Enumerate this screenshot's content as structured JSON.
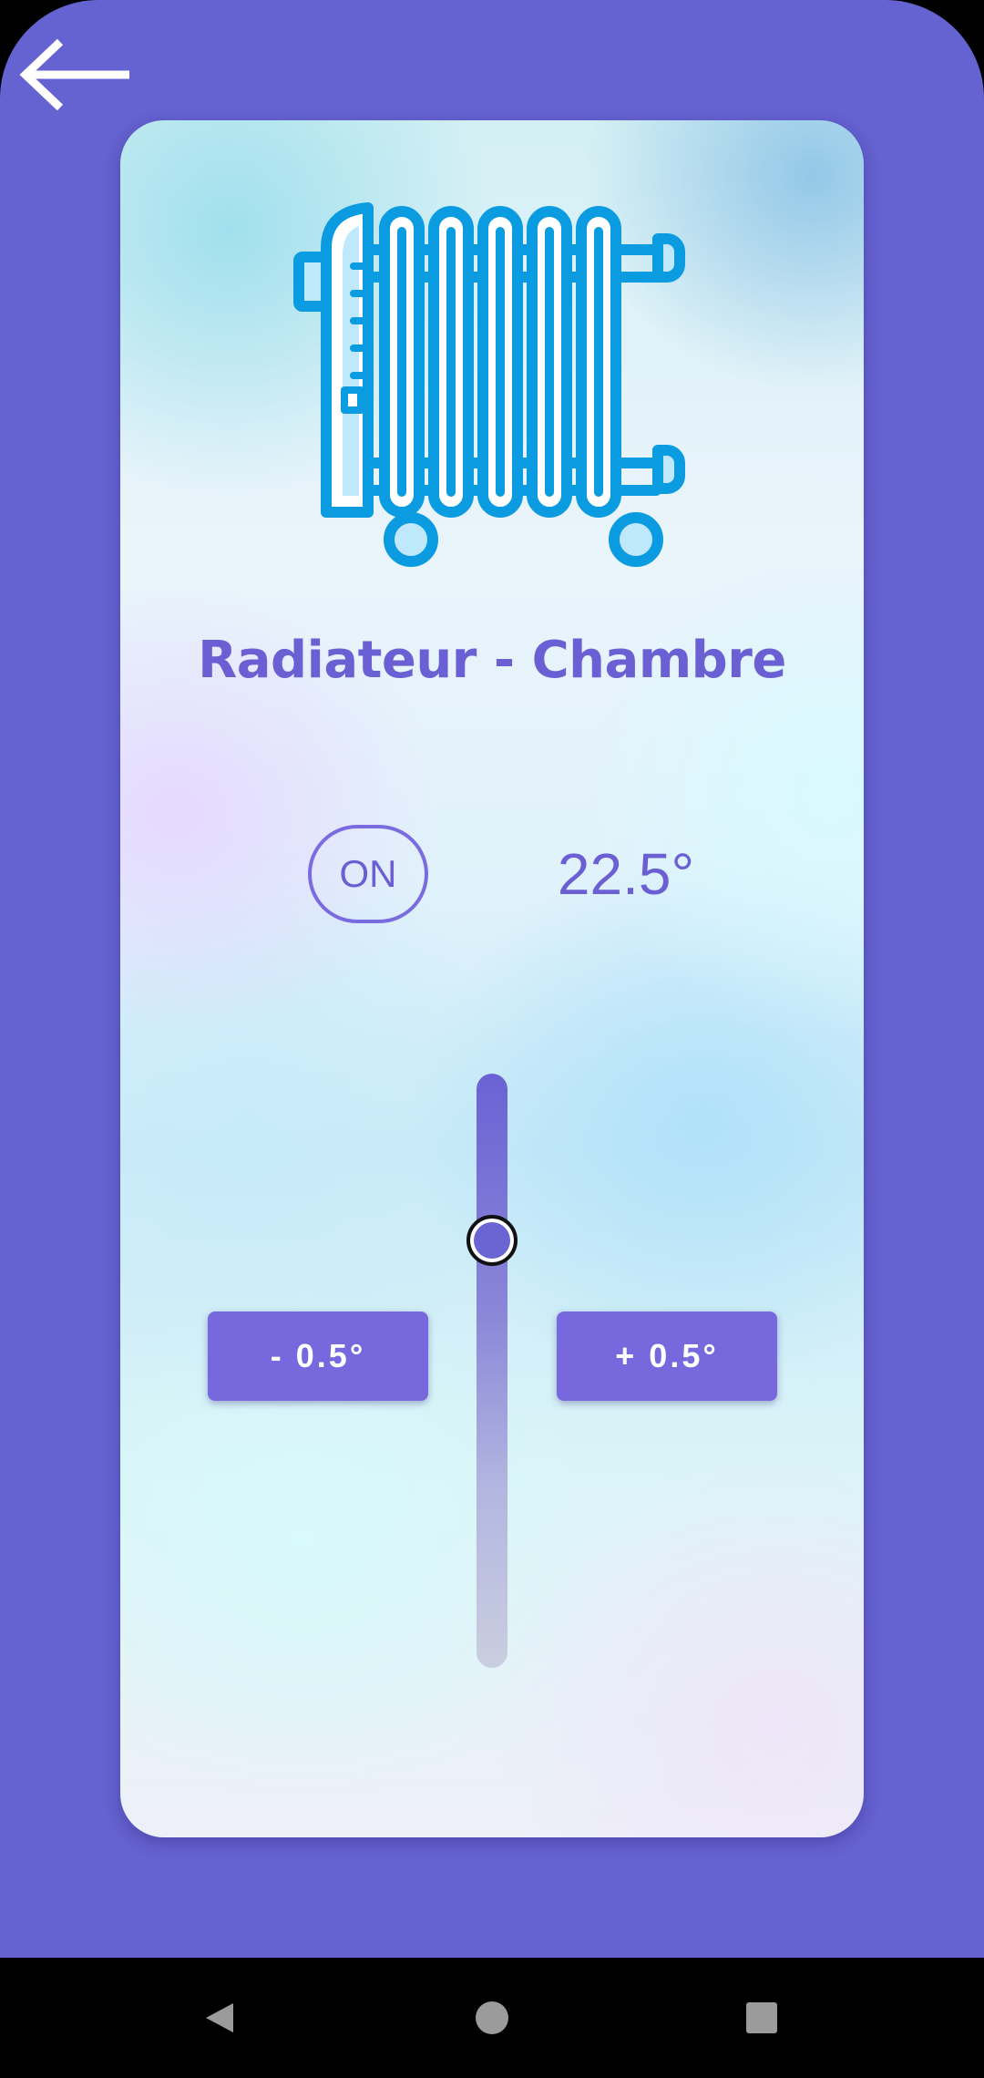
{
  "header": {
    "back_icon": "arrow-left-icon"
  },
  "device": {
    "icon": "radiator-icon",
    "name": "Radiateur - Chambre",
    "power_label": "ON",
    "temperature": "22.5°",
    "setpoint_fraction": 0.28
  },
  "controls": {
    "decrease_label": "- 0.5°",
    "increase_label": "+ 0.5°"
  },
  "navbar": {
    "back_icon": "triangle-back-icon",
    "home_icon": "circle-home-icon",
    "recents_icon": "square-recents-icon"
  },
  "colors": {
    "background": "#6562d1",
    "accent": "#6b5fd3",
    "button": "#7868de",
    "icon_blue": "#0a9be0",
    "icon_fill": "#bfe8fa"
  }
}
